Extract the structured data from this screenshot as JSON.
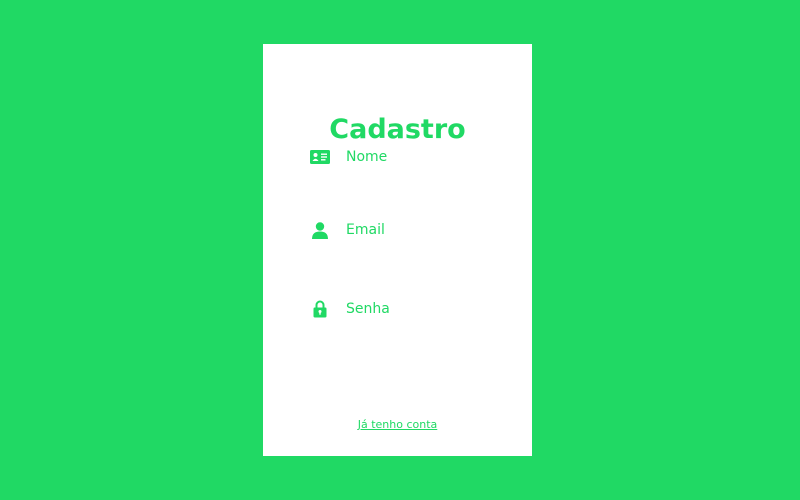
{
  "form": {
    "title": "Cadastro",
    "fields": [
      {
        "placeholder": "Nome",
        "value": "",
        "icon": "id-card-icon"
      },
      {
        "placeholder": "Email",
        "value": "",
        "icon": "user-icon"
      },
      {
        "placeholder": "Senha",
        "value": "",
        "icon": "lock-icon"
      }
    ],
    "login_link": "Já tenho conta"
  },
  "colors": {
    "background": "#20d964",
    "card": "#ffffff",
    "accent": "#20d964"
  }
}
